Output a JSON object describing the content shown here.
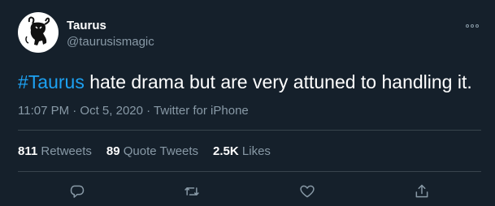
{
  "user": {
    "display_name": "Taurus",
    "handle": "@taurusismagic"
  },
  "tweet": {
    "hashtag": "#Taurus",
    "body": " hate drama but are very attuned to handling it.",
    "timestamp": "11:07 PM · Oct 5, 2020 · Twitter for iPhone"
  },
  "stats": {
    "retweets_count": "811",
    "retweets_label": "Retweets",
    "quotes_count": "89",
    "quotes_label": "Quote Tweets",
    "likes_count": "2.5K",
    "likes_label": "Likes"
  },
  "icons": {
    "more": "more-icon",
    "reply": "reply-icon",
    "retweet": "retweet-icon",
    "like": "like-icon",
    "share": "share-icon"
  },
  "colors": {
    "background": "#15202b",
    "accent": "#1da1f2",
    "secondary_text": "#8899a6",
    "divider": "#38444d"
  }
}
